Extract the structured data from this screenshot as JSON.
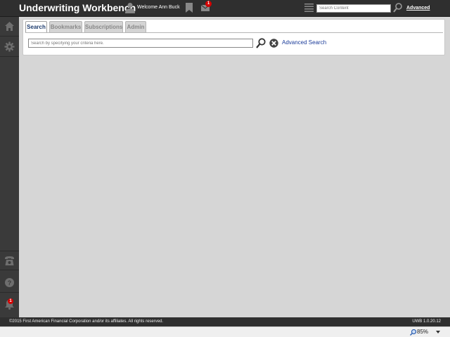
{
  "header": {
    "app_title": "Underwriting Workbench",
    "welcome": "Welcome Ann Buck",
    "mail_count": "1",
    "search_placeholder": "Search Content",
    "advanced_label": "Advanced"
  },
  "sidebar": {
    "items": [
      {
        "icon": "home-icon"
      },
      {
        "icon": "gear-icon"
      },
      {
        "icon": "phone-icon"
      },
      {
        "icon": "help-icon"
      },
      {
        "icon": "bell-icon"
      }
    ],
    "notification_count": "1"
  },
  "tabs": [
    {
      "label": "Search",
      "active": true
    },
    {
      "label": "Bookmarks",
      "active": false
    },
    {
      "label": "Subscriptions",
      "active": false
    },
    {
      "label": "Admin",
      "active": false
    }
  ],
  "search": {
    "placeholder": "Search by specifying your criteria here.",
    "advanced_search_label": "Advanced Search"
  },
  "footer": {
    "copyright": "©2015 First American Financial Corporation and/or its affiliates. All rights reserved.",
    "version": "UWB 1.0.20.12"
  },
  "statusbar": {
    "zoom": "85%"
  },
  "colors": {
    "header_bg": "#2f2f2f",
    "sidebar_bg": "#3a3a3a",
    "content_bg": "#d6d6d6",
    "badge": "#d40000",
    "active_tab_text": "#1d3c6e",
    "link": "#1b3c9a"
  }
}
